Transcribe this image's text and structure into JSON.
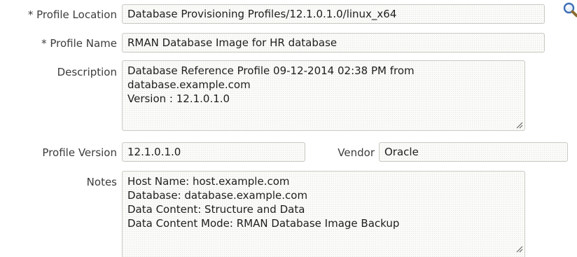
{
  "profile_location": {
    "label": "* Profile Location",
    "value": "Database Provisioning Profiles/12.1.0.1.0/linux_x64",
    "search_icon": "magnifier-search-icon"
  },
  "profile_name": {
    "label": "* Profile Name",
    "value": "RMAN Database Image for HR database"
  },
  "description": {
    "label": "Description",
    "lines": [
      "Database Reference Profile 09-12-2014 02:38 PM from",
      "database.example.com",
      "Version : 12.1.0.1.0"
    ]
  },
  "profile_version": {
    "label": "Profile Version",
    "value": "12.1.0.1.0"
  },
  "vendor": {
    "label": "Vendor",
    "value": "Oracle"
  },
  "notes": {
    "label": "Notes",
    "lines": [
      "Host Name: host.example.com",
      "Database: database.example.com",
      "Data Content: Structure and Data",
      "Data Content Mode: RMAN Database Image Backup"
    ]
  },
  "colors": {
    "label_text": "#3c3c3c",
    "field_border": "#c9c9c4",
    "field_bg": "#fbfbf9",
    "icon_accent": "#3f6fb3"
  }
}
